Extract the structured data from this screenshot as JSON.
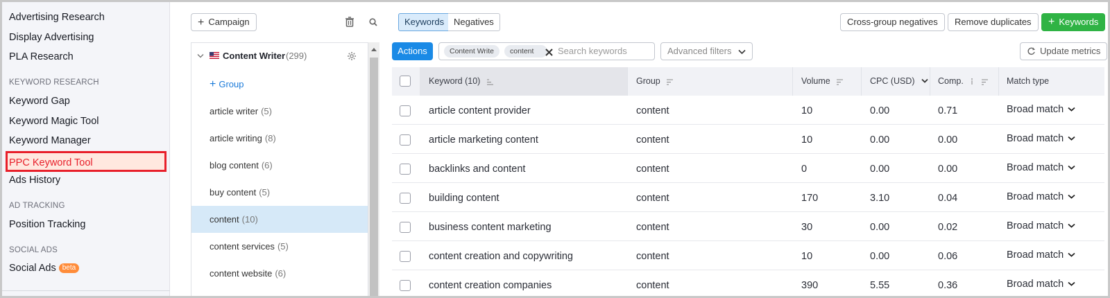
{
  "sidebar": {
    "top_items": [
      "Advertising Research",
      "Display Advertising",
      "PLA Research"
    ],
    "section_keyword": "KEYWORD RESEARCH",
    "keyword_items": [
      "Keyword Gap",
      "Keyword Magic Tool",
      "Keyword Manager"
    ],
    "active_item": "PPC Keyword Tool",
    "ads_history": "Ads History",
    "section_tracking": "AD TRACKING",
    "tracking_item": "Position Tracking",
    "section_social": "SOCIAL ADS",
    "social_item": "Social Ads",
    "social_badge": "beta"
  },
  "campaign_panel": {
    "add_campaign_label": "Campaign",
    "campaign_name": "Content Writer",
    "campaign_count": "(299)",
    "add_group_label": "Group",
    "groups": [
      {
        "name": "article writer",
        "count": "(5)"
      },
      {
        "name": "article writing",
        "count": "(8)"
      },
      {
        "name": "blog content",
        "count": "(6)"
      },
      {
        "name": "buy content",
        "count": "(5)"
      },
      {
        "name": "content",
        "count": "(10)"
      },
      {
        "name": "content services",
        "count": "(5)"
      },
      {
        "name": "content website",
        "count": "(6)"
      }
    ],
    "selected_group": "content"
  },
  "main": {
    "tabs": {
      "keywords": "Keywords",
      "negatives": "Negatives"
    },
    "cross_group_label": "Cross-group negatives",
    "remove_duplicates_label": "Remove duplicates",
    "add_keywords_label": "Keywords",
    "actions_label": "Actions",
    "chips": {
      "campaign": "Content Write",
      "group": "content"
    },
    "search_placeholder": "Search keywords",
    "advanced_filters_label": "Advanced filters",
    "update_metrics_label": "Update metrics"
  },
  "table": {
    "headers": {
      "keyword": "Keyword (10)",
      "group": "Group",
      "volume": "Volume",
      "cpc": "CPC (USD)",
      "comp": "Comp.",
      "match": "Match type"
    },
    "rows": [
      {
        "keyword": "article content provider",
        "group": "content",
        "volume": "10",
        "cpc": "0.00",
        "comp": "0.71",
        "match": "Broad match"
      },
      {
        "keyword": "article marketing content",
        "group": "content",
        "volume": "10",
        "cpc": "0.00",
        "comp": "0.00",
        "match": "Broad match"
      },
      {
        "keyword": "backlinks and content",
        "group": "content",
        "volume": "0",
        "cpc": "0.00",
        "comp": "0.00",
        "match": "Broad match"
      },
      {
        "keyword": "building content",
        "group": "content",
        "volume": "170",
        "cpc": "3.10",
        "comp": "0.04",
        "match": "Broad match"
      },
      {
        "keyword": "business content marketing",
        "group": "content",
        "volume": "30",
        "cpc": "0.00",
        "comp": "0.02",
        "match": "Broad match"
      },
      {
        "keyword": "content creation and copywriting",
        "group": "content",
        "volume": "10",
        "cpc": "0.00",
        "comp": "0.06",
        "match": "Broad match"
      },
      {
        "keyword": "content creation companies",
        "group": "content",
        "volume": "390",
        "cpc": "5.55",
        "comp": "0.36",
        "match": "Broad match"
      }
    ]
  },
  "colors": {
    "highlight_border": "#e8202b",
    "highlight_fill": "#ffe8df",
    "primary_blue": "#1a8ae6",
    "green": "#2fb344",
    "selected_row": "#d6e9f8"
  }
}
